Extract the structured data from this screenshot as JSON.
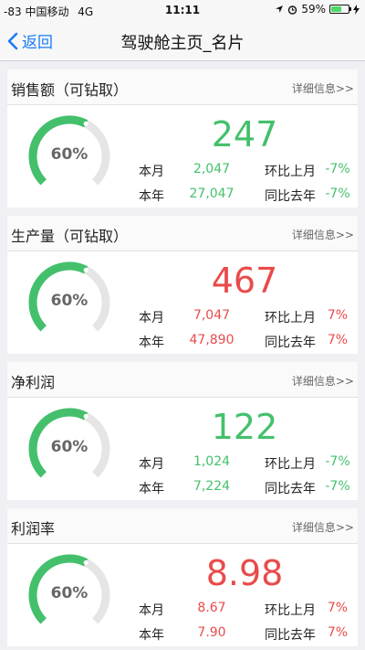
{
  "status": {
    "signal": "-83",
    "carrier": "中国移动",
    "network": "4G",
    "time": "11:11",
    "battery": "59%",
    "battery_level": 0.59
  },
  "nav": {
    "back_label": "返回",
    "title": "驾驶舱主页_名片"
  },
  "colors": {
    "green": "#44c06c",
    "red": "#e94b4b",
    "accent": "#1a7cf5",
    "track": "#e5e5e5"
  },
  "cards": [
    {
      "title": "销售额（可钻取）",
      "detail": "详细信息>>",
      "gauge_value": 0.6,
      "gauge_label": "60%",
      "value": "247",
      "color": "green",
      "month_label": "本月",
      "month_value": "2,047",
      "mom_label": "环比上月",
      "mom_value": "-7%",
      "year_label": "本年",
      "year_value": "27,047",
      "yoy_label": "同比去年",
      "yoy_value": "-7%"
    },
    {
      "title": "生产量（可钻取）",
      "detail": "详细信息>>",
      "gauge_value": 0.6,
      "gauge_label": "60%",
      "value": "467",
      "color": "red",
      "month_label": "本月",
      "month_value": "7,047",
      "mom_label": "环比上月",
      "mom_value": "7%",
      "year_label": "本年",
      "year_value": "47,890",
      "yoy_label": "同比去年",
      "yoy_value": "7%"
    },
    {
      "title": "净利润",
      "detail": "详细信息>>",
      "gauge_value": 0.6,
      "gauge_label": "60%",
      "value": "122",
      "color": "green",
      "month_label": "本月",
      "month_value": "1,024",
      "mom_label": "环比上月",
      "mom_value": "-7%",
      "year_label": "本年",
      "year_value": "7,224",
      "yoy_label": "同比去年",
      "yoy_value": "-7%"
    },
    {
      "title": "利润率",
      "detail": "详细信息>>",
      "gauge_value": 0.6,
      "gauge_label": "60%",
      "value": "8.98",
      "color": "red",
      "month_label": "本月",
      "month_value": "8.67",
      "mom_label": "环比上月",
      "mom_value": "7%",
      "year_label": "本年",
      "year_value": "7.90",
      "yoy_label": "同比去年",
      "yoy_value": "7%"
    }
  ]
}
